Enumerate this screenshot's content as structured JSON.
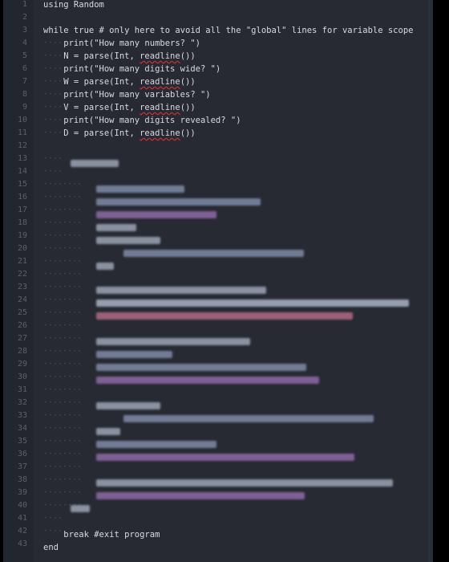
{
  "editor": {
    "line_numbers": [
      "1",
      "2",
      "3",
      "4",
      "5",
      "6",
      "7",
      "8",
      "9",
      "10",
      "11",
      "12",
      "13",
      "14",
      "15",
      "16",
      "17",
      "18",
      "19",
      "20",
      "21",
      "22",
      "23",
      "24",
      "25",
      "26",
      "27",
      "28",
      "29",
      "30",
      "31",
      "32",
      "33",
      "34",
      "35",
      "36",
      "37",
      "38",
      "39",
      "40",
      "41",
      "42",
      "43"
    ],
    "lines": {
      "l1": "using Random",
      "l3": "while true # only here to avoid all the \"global\" lines for variable scope",
      "l4": "    print(\"How many numbers? \")",
      "l5": "    N = parse(Int, readline())",
      "l6": "    print(\"How many digits wide? \")",
      "l7": "    W = parse(Int, readline())",
      "l8": "    print(\"How many variables? \")",
      "l9": "    V = parse(Int, readline())",
      "l10": "    print(\"How many digits revealed? \")",
      "l11": "    D = parse(Int, readline())",
      "l42": "    break #exit program",
      "l43": "end"
    }
  }
}
